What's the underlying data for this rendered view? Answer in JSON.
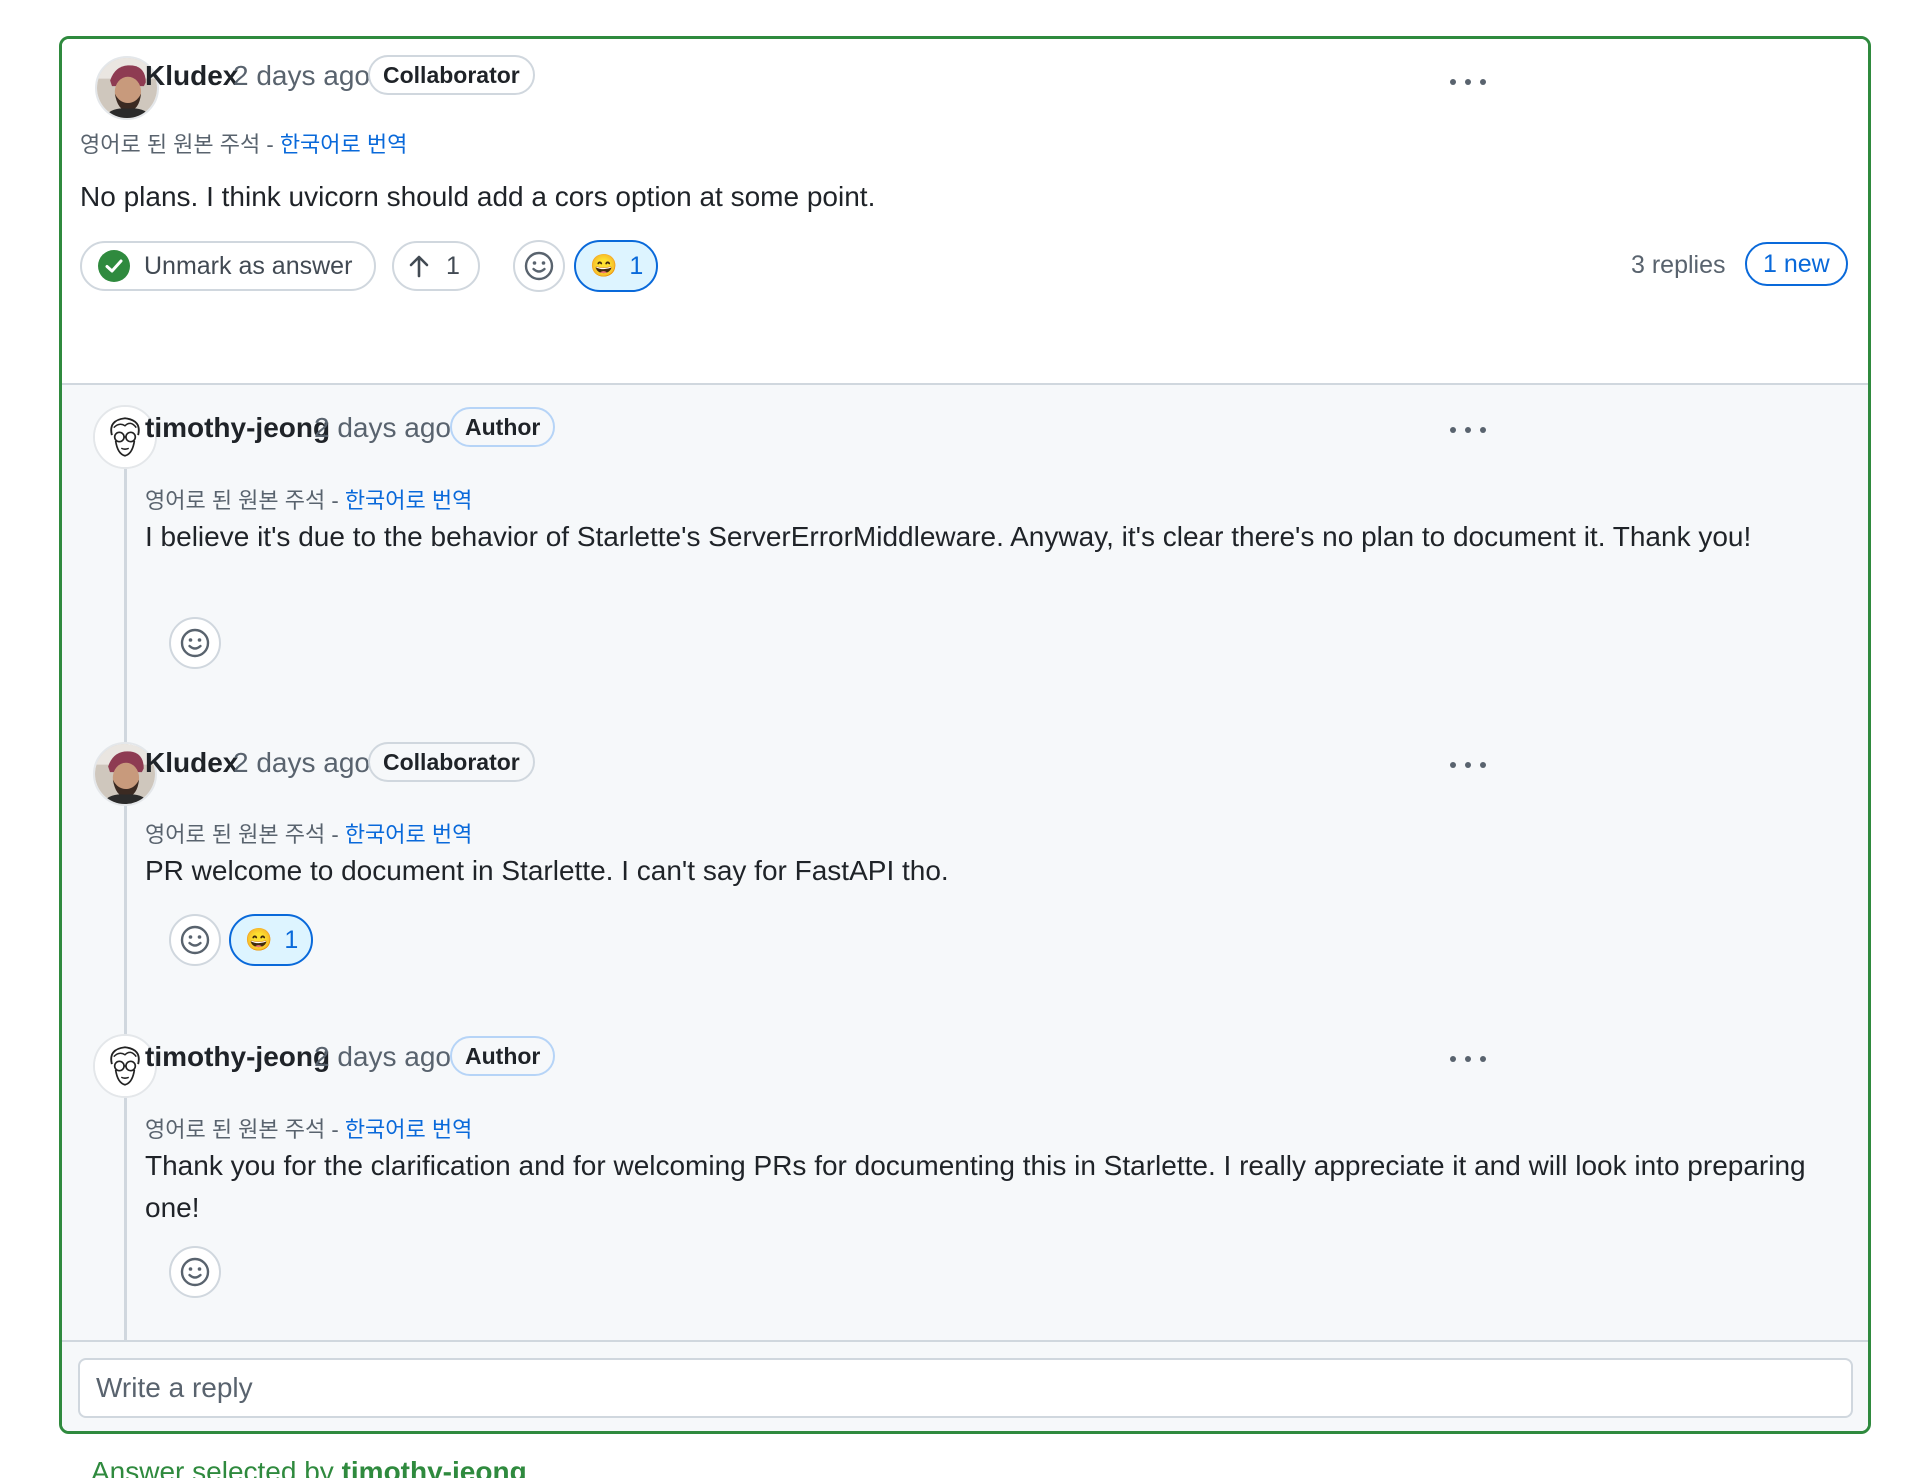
{
  "translate": {
    "prefix": "영어로 된 원본 주석 - ",
    "link": "한국어로 번역"
  },
  "main": {
    "author": "Kludex",
    "time": "2 days ago",
    "badge": "Collaborator",
    "body": "No plans. I think uvicorn should add a cors option at some point.",
    "unmark_label": "Unmark as answer",
    "upvote_count": "1",
    "reaction_emoji": "😄",
    "reaction_count": "1",
    "replies_count": "3 replies",
    "new_label": "1 new"
  },
  "replies": [
    {
      "author": "timothy-jeong",
      "time": "2 days ago",
      "badge": "Author",
      "body": "I believe it's due to the behavior of Starlette's ServerErrorMiddleware. Anyway, it's clear there's no plan to document it. Thank you!"
    },
    {
      "author": "Kludex",
      "time": "2 days ago",
      "badge": "Collaborator",
      "body": "PR welcome to document in Starlette. I can't say for FastAPI tho.",
      "reaction_emoji": "😄",
      "reaction_count": "1"
    },
    {
      "author": "timothy-jeong",
      "time": "2 days ago",
      "badge": "Author",
      "body": "Thank you for the clarification and for welcoming PRs for documenting this in Starlette. I really appreciate it and will look into preparing one!"
    }
  ],
  "reply_placeholder": "Write a reply",
  "answered_by": {
    "prefix": "Answer selected by ",
    "user": "timothy-jeong"
  },
  "colors": {
    "answer_border": "#2f8a3e",
    "link": "#0969da",
    "thread_bg": "#f6f8fa"
  }
}
